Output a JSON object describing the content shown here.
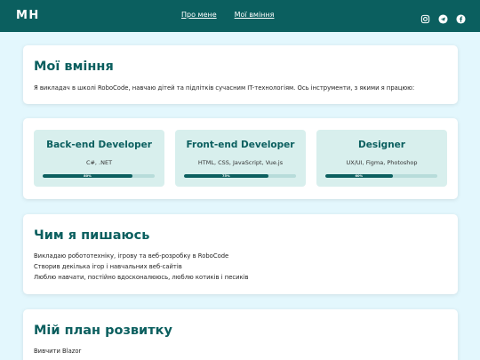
{
  "header": {
    "logo": "МН",
    "nav": [
      "Про мене",
      "Мої вміння"
    ],
    "socials": [
      "instagram-icon",
      "telegram-icon",
      "facebook-icon"
    ],
    "color": "#0b5f5f"
  },
  "skills_intro": {
    "title": "Мої вміння",
    "text": "Я викладач в школі RoboCode, навчаю дітей та підлітків сучасним IT-технологіям. Ось інструменти, з якими я працюю:"
  },
  "skills": [
    {
      "title": "Back-end Developer",
      "tech": "C#, .NET",
      "percent": 80,
      "label": "80%"
    },
    {
      "title": "Front-end Developer",
      "tech": "HTML, CSS, JavaScript, Vue.js",
      "percent": 75,
      "label": "75%"
    },
    {
      "title": "Designer",
      "tech": "UX/UI, Figma, Photoshop",
      "percent": 60,
      "label": "60%"
    }
  ],
  "proud": {
    "title": "Чим я пишаюсь",
    "items": [
      "Викладаю робототехніку, ігрову та веб-розробку в RoboCode",
      "Створив декілька ігор і навчальних веб-сайтів",
      "Люблю навчати, постійно вдосконалююсь, люблю котиків і песиків"
    ]
  },
  "plan": {
    "title": "Мій план розвитку",
    "items": [
      "Вивчити Blazor"
    ]
  }
}
